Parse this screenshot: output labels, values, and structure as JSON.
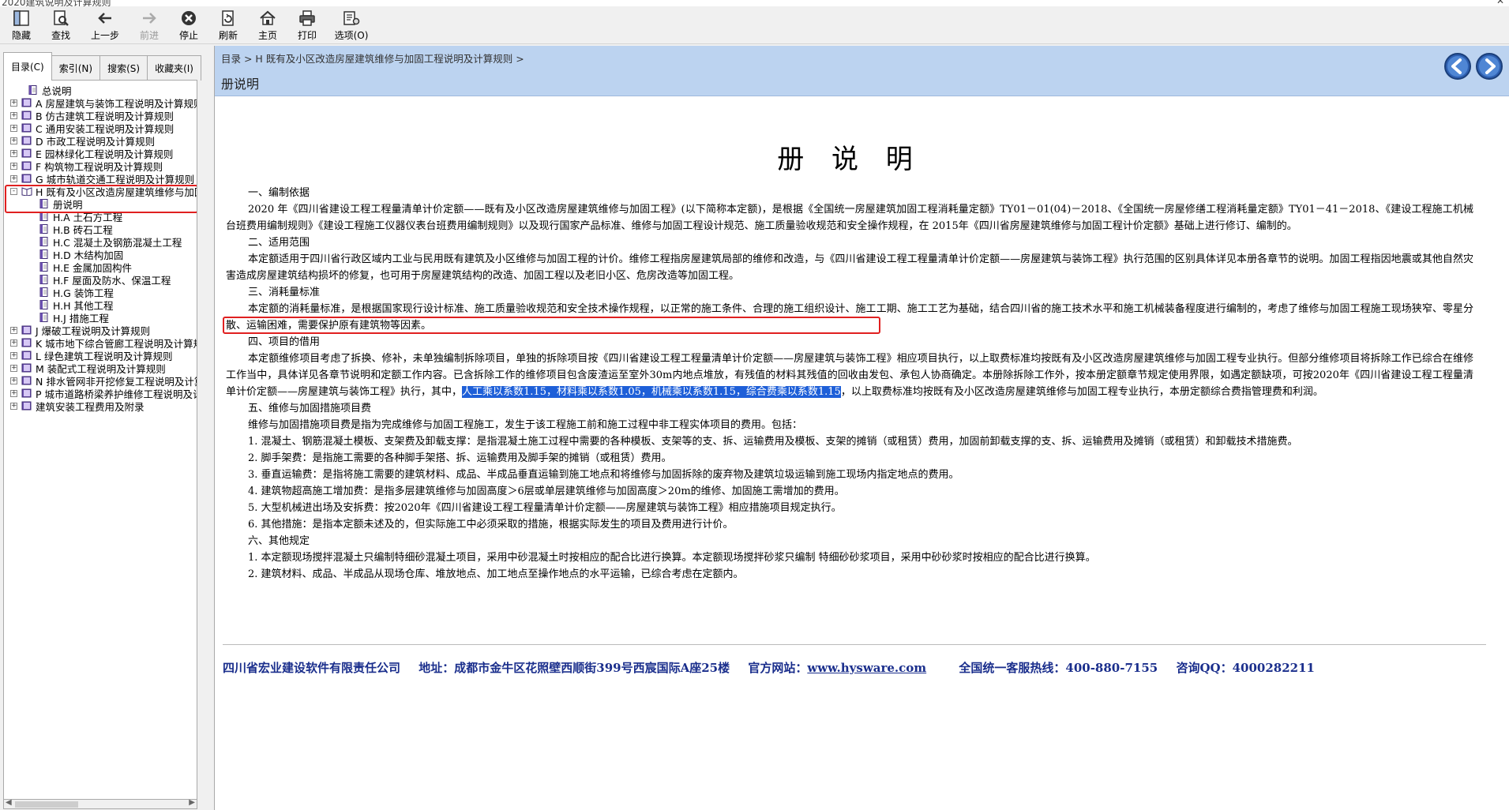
{
  "window": {
    "title": "2020建筑说明及计算规则"
  },
  "toolbar": [
    {
      "id": "hide",
      "label": "隐藏",
      "icon": "hide-icon",
      "disabled": false
    },
    {
      "id": "find",
      "label": "查找",
      "icon": "find-icon",
      "disabled": false
    },
    {
      "id": "back",
      "label": "上一步",
      "icon": "back-arrow-icon",
      "disabled": false
    },
    {
      "id": "forward",
      "label": "前进",
      "icon": "forward-arrow-icon",
      "disabled": true
    },
    {
      "id": "stop",
      "label": "停止",
      "icon": "stop-icon",
      "disabled": false
    },
    {
      "id": "refresh",
      "label": "刷新",
      "icon": "refresh-icon",
      "disabled": false
    },
    {
      "id": "home",
      "label": "主页",
      "icon": "home-icon",
      "disabled": false
    },
    {
      "id": "print",
      "label": "打印",
      "icon": "print-icon",
      "disabled": false
    },
    {
      "id": "options",
      "label": "选项(O)",
      "icon": "options-icon",
      "disabled": false
    }
  ],
  "sidebar": {
    "tabs": [
      {
        "label": "目录(C)",
        "active": true
      },
      {
        "label": "索引(N)",
        "active": false
      },
      {
        "label": "搜索(S)",
        "active": false
      },
      {
        "label": "收藏夹(I)",
        "active": false
      }
    ],
    "tree": [
      {
        "text": "总说明",
        "level": 1,
        "expander": "",
        "icon": "page",
        "selected": false
      },
      {
        "text": "A  房屋建筑与装饰工程说明及计算规则",
        "level": 0,
        "expander": "+",
        "icon": "book",
        "selected": false
      },
      {
        "text": "B  仿古建筑工程说明及计算规则",
        "level": 0,
        "expander": "+",
        "icon": "book",
        "selected": false
      },
      {
        "text": "C  通用安装工程说明及计算规则",
        "level": 0,
        "expander": "+",
        "icon": "book",
        "selected": false
      },
      {
        "text": "D  市政工程说明及计算规则",
        "level": 0,
        "expander": "+",
        "icon": "book",
        "selected": false
      },
      {
        "text": "E  园林绿化工程说明及计算规则",
        "level": 0,
        "expander": "+",
        "icon": "book",
        "selected": false
      },
      {
        "text": "F  构筑物工程说明及计算规则",
        "level": 0,
        "expander": "+",
        "icon": "book",
        "selected": false
      },
      {
        "text": "G  城市轨道交通工程说明及计算规则",
        "level": 0,
        "expander": "+",
        "icon": "book",
        "selected": false
      },
      {
        "text": "H  既有及小区改造房屋建筑维修与加固工程说明及计算规则",
        "level": 0,
        "expander": "-",
        "icon": "book-open",
        "selected": false
      },
      {
        "text": "册说明",
        "level": 2,
        "expander": "",
        "icon": "page",
        "selected": true
      },
      {
        "text": "H.A  土石方工程",
        "level": 2,
        "expander": "",
        "icon": "page",
        "selected": false
      },
      {
        "text": "H.B  砖石工程",
        "level": 2,
        "expander": "",
        "icon": "page",
        "selected": false
      },
      {
        "text": "H.C  混凝土及钢筋混凝土工程",
        "level": 2,
        "expander": "",
        "icon": "page",
        "selected": false
      },
      {
        "text": "H.D  木结构加固",
        "level": 2,
        "expander": "",
        "icon": "page",
        "selected": false
      },
      {
        "text": "H.E  金属加固构件",
        "level": 2,
        "expander": "",
        "icon": "page",
        "selected": false
      },
      {
        "text": "H.F  屋面及防水、保温工程",
        "level": 2,
        "expander": "",
        "icon": "page",
        "selected": false
      },
      {
        "text": "H.G  装饰工程",
        "level": 2,
        "expander": "",
        "icon": "page",
        "selected": false
      },
      {
        "text": "H.H  其他工程",
        "level": 2,
        "expander": "",
        "icon": "page",
        "selected": false
      },
      {
        "text": "H.J  措施工程",
        "level": 2,
        "expander": "",
        "icon": "page",
        "selected": false
      },
      {
        "text": "J  爆破工程说明及计算规则",
        "level": 0,
        "expander": "+",
        "icon": "book",
        "selected": false
      },
      {
        "text": "K  城市地下综合管廊工程说明及计算规则",
        "level": 0,
        "expander": "+",
        "icon": "book",
        "selected": false
      },
      {
        "text": "L  绿色建筑工程说明及计算规则",
        "level": 0,
        "expander": "+",
        "icon": "book",
        "selected": false
      },
      {
        "text": "M  装配式工程说明及计算规则",
        "level": 0,
        "expander": "+",
        "icon": "book",
        "selected": false
      },
      {
        "text": "N  排水管网非开挖修复工程说明及计算规则",
        "level": 0,
        "expander": "+",
        "icon": "book",
        "selected": false
      },
      {
        "text": "P  城市道路桥梁养护维修工程说明及计算规则",
        "level": 0,
        "expander": "+",
        "icon": "book",
        "selected": false
      },
      {
        "text": "建筑安装工程费用及附录",
        "level": 0,
        "expander": "+",
        "icon": "book",
        "selected": false
      }
    ]
  },
  "content": {
    "breadcrumb": "目录 > H 既有及小区改造房屋建筑维修与加固工程说明及计算规则 >",
    "section_title": "册说明",
    "doc_title": "册 说 明",
    "s1_heading": "一、编制依据",
    "s1_body": "2020 年《四川省建设工程工程量清单计价定额——既有及小区改造房屋建筑维修与加固工程》(以下简称本定额)，是根据《全国统一房屋建筑加固工程消耗量定额》TY01－01(04)－2018、《全国统一房屋修缮工程消耗量定额》TY01－41－2018、《建设工程施工机械台班费用编制规则》《建设工程施工仪器仪表台班费用编制规则》以及现行国家产品标准、维修与加固工程设计规范、施工质量验收规范和安全操作规程，在 2015年《四川省房屋建筑维修与加固工程计价定额》基础上进行修订、编制的。",
    "s2_heading": "二、适用范围",
    "s2_body": "本定额适用于四川省行政区域内工业与民用既有建筑及小区维修与加固工程的计价。维修工程指房屋建筑局部的维修和改造，与《四川省建设工程工程量清单计价定额——房屋建筑与装饰工程》执行范围的区别具体详见本册各章节的说明。加固工程指因地震或其他自然灾害造成房屋建筑结构损坏的修复，也可用于房屋建筑结构的改造、加固工程以及老旧小区、危房改造等加固工程。",
    "s3_heading": "三、消耗量标准",
    "s3_body": "本定额的消耗量标准，是根据国家现行设计标准、施工质量验收规范和安全技术操作规程，以正常的施工条件、合理的施工组织设计、施工工期、施工工艺为基础，结合四川省的施工技术水平和施工机械装备程度进行编制的，考虑了维修与加固工程施工现场狭窄、零星分散、运输困难，需要保护原有建筑物等因素。",
    "s4_heading": "四、项目的借用",
    "s4_body_a": "本定额维修项目考虑了拆换、修补，未单独编制拆除项目，单独的拆除项目按《四川省建设工程工程量清单计价定额——房屋建筑与装饰工程》相应项目执行，以上取费标准均按既有及小区改造房屋建筑维修与加固工程专业执行。但部分维修项目将拆除工作已综合在维修工作当中，具体详见各章节说明和定额工作内容。已含拆除工作的维修项目包含废渣运至室外30m内地点堆放，有残值的材料其残值的回收由发包、承包人协商确定。本册除拆除工作外，按本册定额章节规定使用界限，如遇定额缺项，可按2020年《四川省建设工程工程量清单计价定额——房屋建筑与装饰工程》执行，其中，",
    "s4_body_sel": "人工乘以系数1.15，材料乘以系数1.05，机械乘以系数1.15，综合费乘以系数1.15",
    "s4_body_b": "，以上取费标准均按既有及小区改造房屋建筑维修与加固工程专业执行，本册定额综合费指管理费和利润。",
    "s5_heading": "五、维修与加固措施项目费",
    "s5_intro": "维修与加固措施项目费是指为完成维修与加固工程施工，发生于该工程施工前和施工过程中非工程实体项目的费用。包括：",
    "s5_items": [
      "1. 混凝土、钢筋混凝土模板、支架费及卸载支撑：是指混凝土施工过程中需要的各种模板、支架等的支、拆、运输费用及模板、支架的摊销（或租赁）费用，加固前卸载支撑的支、拆、运输费用及摊销（或租赁）和卸载技术措施费。",
      "2. 脚手架费：是指施工需要的各种脚手架搭、拆、运输费用及脚手架的摊销（或租赁）费用。",
      "3. 垂直运输费：是指将施工需要的建筑材料、成品、半成品垂直运输到施工地点和将维修与加固拆除的废弃物及建筑垃圾运输到施工现场内指定地点的费用。",
      "4. 建筑物超高施工增加费：是指多层建筑维修与加固高度＞6层或单层建筑维修与加固高度＞20m的维修、加固施工需增加的费用。",
      "5. 大型机械进出场及安拆费：按2020年《四川省建设工程工程量清单计价定额——房屋建筑与装饰工程》相应措施项目规定执行。",
      "6. 其他措施：是指本定额未述及的，但实际施工中必须采取的措施，根据实际发生的项目及费用进行计价。"
    ],
    "s6_heading": "六、其他规定",
    "s6_items": [
      "1. 本定额现场搅拌混凝土只编制特细砂混凝土项目，采用中砂混凝土时按相应的配合比进行换算。本定额现场搅拌砂浆只编制 特细砂砂浆项目，采用中砂砂浆时按相应的配合比进行换算。",
      "2. 建筑材料、成品、半成品从现场仓库、堆放地点、加工地点至操作地点的水平运输，已综合考虑在定额内。"
    ],
    "footer": {
      "company": "四川省宏业建设软件有限责任公司",
      "address": "地址：成都市金牛区花照壁西顺街399号西宸国际A座25楼",
      "website_label": "官方网站：",
      "website": "www.hysware.com",
      "hotline": "全国统一客服热线：400-880-7155",
      "qq": "咨询QQ：4000282211"
    }
  },
  "colors": {
    "banner": "#bcd3f0",
    "selection": "#1e5fd8",
    "annotation_box": "#e02020",
    "footer_text": "#1a2e8c"
  }
}
